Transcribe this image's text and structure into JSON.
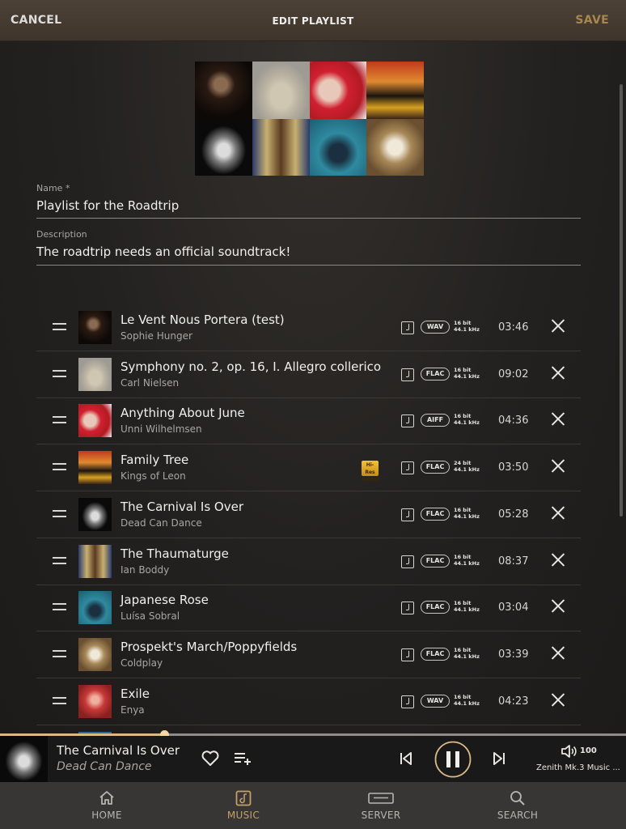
{
  "header": {
    "cancel_label": "CANCEL",
    "title": "EDIT PLAYLIST",
    "save_label": "SAVE"
  },
  "form": {
    "name_label": "Name *",
    "name_value": "Playlist for the Roadtrip",
    "description_label": "Description",
    "description_value": "The roadtrip needs an official soundtrack!"
  },
  "tracks": [
    {
      "title": "Le Vent Nous Portera (test)",
      "artist": "Sophie Hunger",
      "format": "WAV",
      "bit_depth": "16 bit",
      "sample_rate": "44.1 kHz",
      "duration": "03:46",
      "hires": false
    },
    {
      "title": "Symphony no. 2, op. 16, I. Allegro collerico",
      "artist": "Carl Nielsen",
      "format": "FLAC",
      "bit_depth": "16 bit",
      "sample_rate": "44.1 kHz",
      "duration": "09:02",
      "hires": false
    },
    {
      "title": "Anything About June",
      "artist": "Unni Wilhelmsen",
      "format": "AIFF",
      "bit_depth": "16 bit",
      "sample_rate": "44.1 kHz",
      "duration": "04:36",
      "hires": false
    },
    {
      "title": "Family Tree",
      "artist": "Kings of Leon",
      "format": "FLAC",
      "bit_depth": "24 bit",
      "sample_rate": "44.1 kHz",
      "duration": "03:50",
      "hires": true,
      "hires_badge": "Hi-Res AUDIO"
    },
    {
      "title": "The Carnival Is Over",
      "artist": "Dead Can Dance",
      "format": "FLAC",
      "bit_depth": "16 bit",
      "sample_rate": "44.1 kHz",
      "duration": "05:28",
      "hires": false
    },
    {
      "title": "The Thaumaturge",
      "artist": "Ian Boddy",
      "format": "FLAC",
      "bit_depth": "16 bit",
      "sample_rate": "44.1 kHz",
      "duration": "08:37",
      "hires": false
    },
    {
      "title": "Japanese Rose",
      "artist": "Luísa Sobral",
      "format": "FLAC",
      "bit_depth": "16 bit",
      "sample_rate": "44.1 kHz",
      "duration": "03:04",
      "hires": false
    },
    {
      "title": "Prospekt's March/Poppyfields",
      "artist": "Coldplay",
      "format": "FLAC",
      "bit_depth": "16 bit",
      "sample_rate": "44.1 kHz",
      "duration": "03:39",
      "hires": false
    },
    {
      "title": "Exile",
      "artist": "Enya",
      "format": "WAV",
      "bit_depth": "16 bit",
      "sample_rate": "44.1 kHz",
      "duration": "04:23",
      "hires": false
    }
  ],
  "now_playing": {
    "title": "The Carnival Is Over",
    "artist": "Dead Can Dance",
    "progress": 0.262,
    "volume": "100",
    "zone": "Zenith Mk.3 Music ..."
  },
  "nav": [
    {
      "label": "HOME",
      "icon": "home-icon",
      "active": false
    },
    {
      "label": "MUSIC",
      "icon": "music-icon",
      "active": true
    },
    {
      "label": "SERVER",
      "icon": "server-icon",
      "active": false
    },
    {
      "label": "SEARCH",
      "icon": "search-icon",
      "active": false
    }
  ],
  "colors": {
    "accent": "#c3a068",
    "save": "#a8864f",
    "header_bg": "#4c4136",
    "background": "#232120",
    "hires_badge": "#f1c33b"
  }
}
